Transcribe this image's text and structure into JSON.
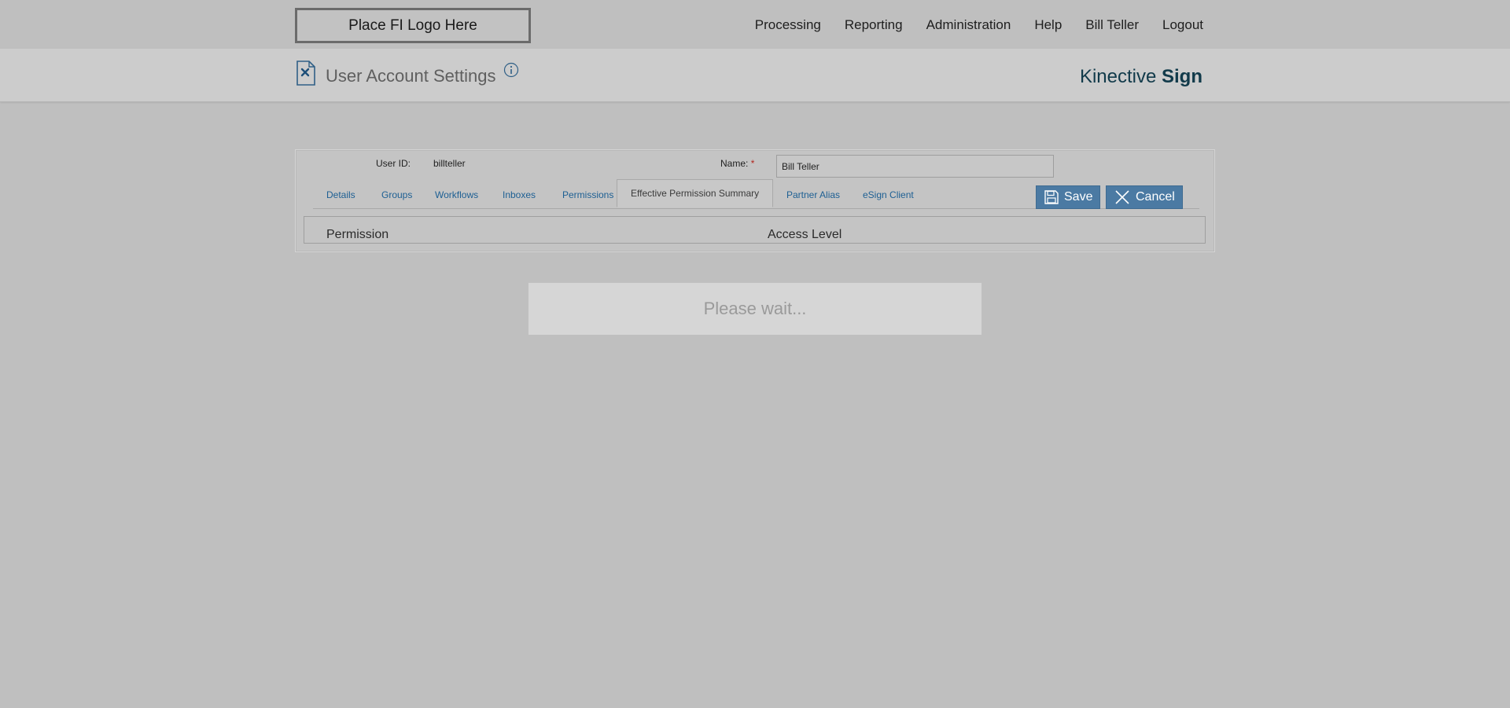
{
  "topbar": {
    "logo_text": "Place FI Logo Here",
    "nav": [
      "Processing",
      "Reporting",
      "Administration",
      "Help",
      "Bill Teller",
      "Logout"
    ]
  },
  "header": {
    "title": "User Account Settings",
    "brand_light": "Kinective ",
    "brand_bold": "Sign"
  },
  "form": {
    "user_id_label": "User ID:",
    "user_id_value": "billteller",
    "name_label": "Name:",
    "required_marker": "*",
    "name_value": "Bill Teller"
  },
  "tabs": [
    {
      "label": "Details",
      "active": false
    },
    {
      "label": "Groups",
      "active": false
    },
    {
      "label": "Workflows",
      "active": false
    },
    {
      "label": "Inboxes",
      "active": false
    },
    {
      "label": "Permissions",
      "active": false
    },
    {
      "label": "Effective Permission Summary",
      "active": true
    },
    {
      "label": "Partner Alias",
      "active": false
    },
    {
      "label": "eSign Client",
      "active": false
    }
  ],
  "actions": {
    "save_label": "Save",
    "cancel_label": "Cancel"
  },
  "grid": {
    "columns": [
      "Permission",
      "Access Level"
    ]
  },
  "overlay": {
    "message": "Please wait..."
  },
  "colors": {
    "accent": "#4b7aa3",
    "tab_link": "#1d5f93",
    "brand": "#113a4a",
    "required": "#b3261e"
  }
}
